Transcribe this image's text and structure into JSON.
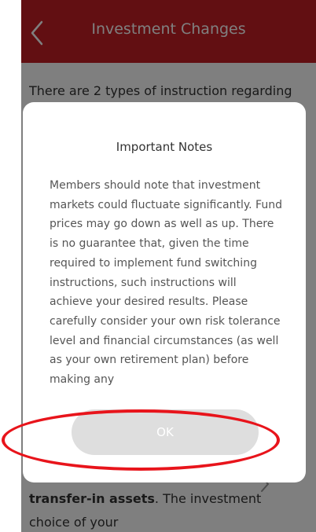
{
  "header": {
    "title": "Investment Changes",
    "back_icon": "chevron-left-icon"
  },
  "background": {
    "intro_text": "There are 2 types of instruction regarding",
    "lower_bold": "transfer-in assets",
    "lower_rest": ". The investment choice of your",
    "chevron_icon": "chevron-right-icon"
  },
  "modal": {
    "title": "Important Notes",
    "body": "Members should note that investment markets could fluctuate significantly. Fund prices may go down as well as up. There is no guarantee that, given the time required to implement fund switching instructions, such instructions will achieve your desired results. Please carefully consider your own risk tolerance level and financial circumstances (as well as your own retirement plan) before making any",
    "ok_label": "OK"
  },
  "colors": {
    "brand_red": "#c41e24",
    "annotation": "#e8141b",
    "button_disabled": "#dedede"
  }
}
